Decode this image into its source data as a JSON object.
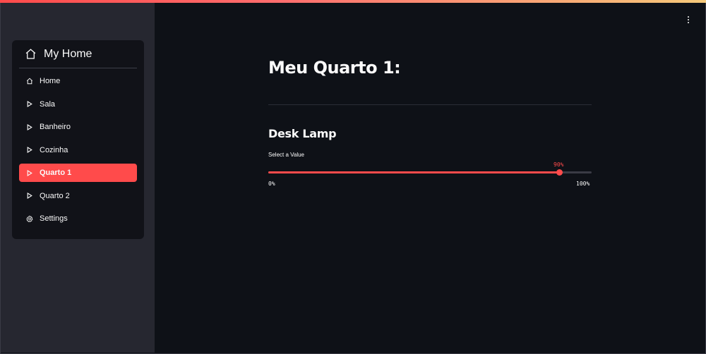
{
  "sidebar": {
    "title": "My Home",
    "title_icon": "home-icon",
    "items": [
      {
        "label": "Home",
        "icon": "home-icon",
        "active": false
      },
      {
        "label": "Sala",
        "icon": "play-outline-icon",
        "active": false
      },
      {
        "label": "Banheiro",
        "icon": "play-outline-icon",
        "active": false
      },
      {
        "label": "Cozinha",
        "icon": "play-outline-icon",
        "active": false
      },
      {
        "label": "Quarto 1",
        "icon": "play-outline-icon",
        "active": true
      },
      {
        "label": "Quarto 2",
        "icon": "play-outline-icon",
        "active": false
      },
      {
        "label": "Settings",
        "icon": "gear-icon",
        "active": false
      }
    ]
  },
  "main": {
    "title": "Meu Quarto 1:",
    "section_title": "Desk Lamp",
    "slider": {
      "label": "Select a Value",
      "value": 90,
      "value_text": "90%",
      "min": 0,
      "max": 100,
      "min_text": "0%",
      "max_text": "100%"
    }
  },
  "colors": {
    "accent": "#ff4b4b",
    "sidebar_bg": "#262730",
    "main_bg": "#0e1117",
    "menu_bg": "#111218"
  }
}
